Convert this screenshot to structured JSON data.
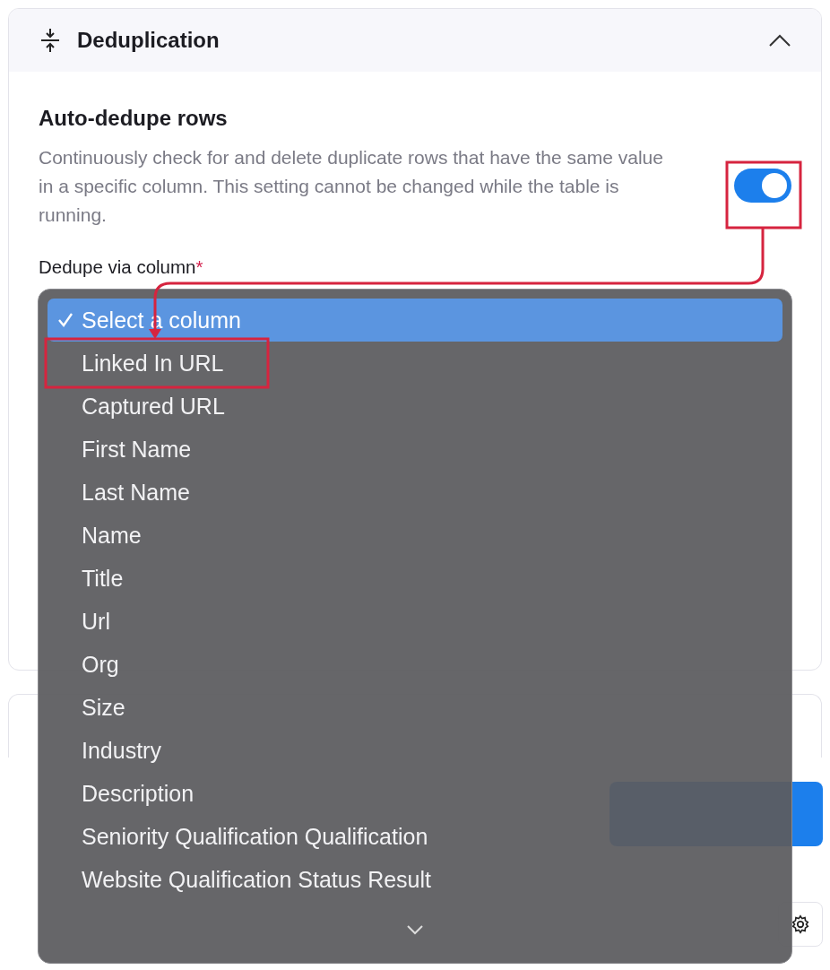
{
  "section": {
    "title": "Deduplication",
    "expanded": true
  },
  "setting": {
    "title": "Auto-dedupe rows",
    "description": "Continuously check for and delete duplicate rows that have the same value in a specific column. This setting cannot be changed while the table is running.",
    "on": true,
    "highlighted": true
  },
  "field": {
    "label": "Dedupe via column",
    "required_mark": "*"
  },
  "menu": {
    "items": [
      {
        "label": "Select a column",
        "selected": true,
        "highlighted": false
      },
      {
        "label": "Linked In URL",
        "selected": false,
        "highlighted": true
      },
      {
        "label": "Captured URL",
        "selected": false,
        "highlighted": false
      },
      {
        "label": "First Name",
        "selected": false,
        "highlighted": false
      },
      {
        "label": "Last Name",
        "selected": false,
        "highlighted": false
      },
      {
        "label": "Name",
        "selected": false,
        "highlighted": false
      },
      {
        "label": "Title",
        "selected": false,
        "highlighted": false
      },
      {
        "label": "Url",
        "selected": false,
        "highlighted": false
      },
      {
        "label": "Org",
        "selected": false,
        "highlighted": false
      },
      {
        "label": "Size",
        "selected": false,
        "highlighted": false
      },
      {
        "label": "Industry",
        "selected": false,
        "highlighted": false
      },
      {
        "label": "Description",
        "selected": false,
        "highlighted": false
      },
      {
        "label": "Seniority Qualification Qualification",
        "selected": false,
        "highlighted": false
      },
      {
        "label": "Website Qualification Status Result",
        "selected": false,
        "highlighted": false
      }
    ]
  }
}
